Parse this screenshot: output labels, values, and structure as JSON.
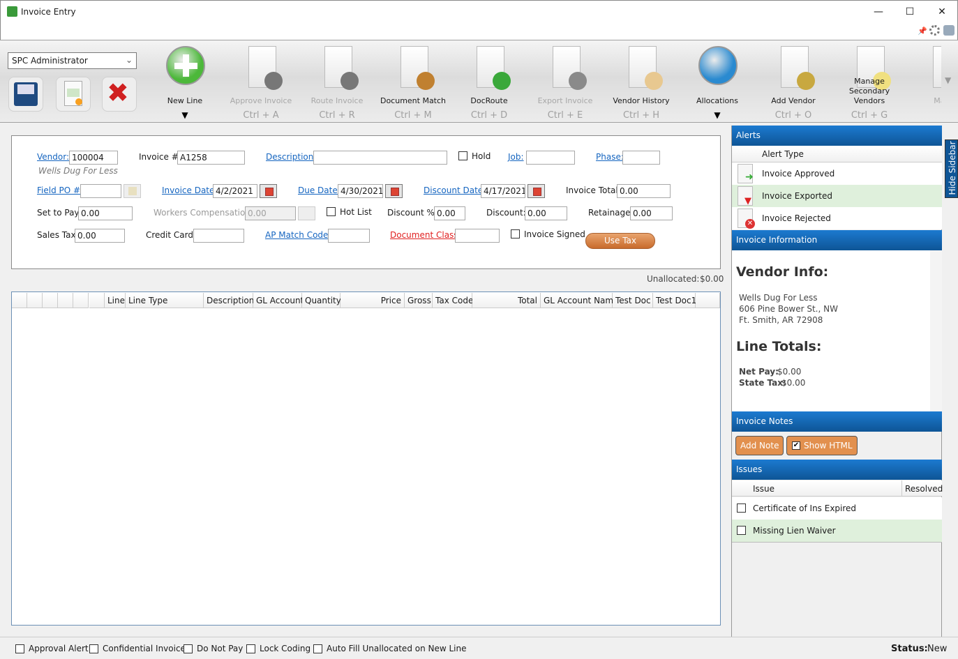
{
  "window": {
    "title": "Invoice Entry",
    "minimize": "—",
    "maximize": "☐",
    "close": "✕"
  },
  "toolbar": {
    "user": "SPC Administrator",
    "buttons": [
      {
        "label": "New Line",
        "shortcut": "▼",
        "enabled": true,
        "icon": "plus-circle-icon",
        "color": "#4cb83a"
      },
      {
        "label": "Approve Invoice",
        "shortcut": "Ctrl + A",
        "enabled": false,
        "icon": "approve-invoice-icon",
        "color": "#777777"
      },
      {
        "label": "Route Invoice",
        "shortcut": "Ctrl + R",
        "enabled": false,
        "icon": "route-invoice-icon",
        "color": "#777777"
      },
      {
        "label": "Document Match",
        "shortcut": "Ctrl + M",
        "enabled": true,
        "icon": "document-search-icon",
        "color": "#c08030"
      },
      {
        "label": "DocRoute",
        "shortcut": "Ctrl + D",
        "enabled": true,
        "icon": "doc-route-icon",
        "color": "#3aa83a"
      },
      {
        "label": "Export Invoice",
        "shortcut": "Ctrl + E",
        "enabled": false,
        "icon": "database-export-icon",
        "color": "#8a8a8a"
      },
      {
        "label": "Vendor History",
        "shortcut": "Ctrl + H",
        "enabled": true,
        "icon": "scroll-clock-icon",
        "color": "#e8c890"
      },
      {
        "label": "Allocations",
        "shortcut": "▼",
        "enabled": true,
        "icon": "pie-chart-icon",
        "color": "#2a8ad0"
      },
      {
        "label": "Add Vendor",
        "shortcut": "Ctrl + O",
        "enabled": true,
        "icon": "add-vendor-icon",
        "color": "#c8a840"
      },
      {
        "label": "Manage Secondary Vendors",
        "shortcut": "Ctrl + G",
        "enabled": true,
        "icon": "sales-quotation-icon",
        "color": "#f0e080"
      },
      {
        "label": "Match",
        "shortcut": "",
        "enabled": false,
        "icon": "match-icon",
        "color": "#aaaaaa"
      }
    ]
  },
  "form": {
    "vendor_label": "Vendor:",
    "vendor": "100004",
    "vendor_name": "Wells Dug For Less",
    "invoice_no_label": "Invoice #:",
    "invoice_no": "A1258",
    "description_label": "Description:",
    "description": "",
    "hold_label": "Hold",
    "job_label": "Job:",
    "job": "",
    "phase_label": "Phase:",
    "phase": "",
    "field_po_label": "Field PO #:",
    "field_po": "",
    "invoice_date_label": "Invoice Date:",
    "invoice_date": "4/2/2021",
    "due_date_label": "Due Date:",
    "due_date": "4/30/2021",
    "discount_date_label": "Discount Date:",
    "discount_date": "4/17/2021",
    "invoice_total_label": "Invoice Total:",
    "invoice_total": "0.00",
    "set_to_pay_label": "Set to Pay:",
    "set_to_pay": "0.00",
    "workers_comp_label": "Workers Compensation:",
    "workers_comp": "0.00",
    "hot_list_label": "Hot List",
    "discount_pct_label": "Discount %:",
    "discount_pct": "0.00",
    "discount_label": "Discount:",
    "discount": "0.00",
    "retainage_label": "Retainage:",
    "retainage": "0.00",
    "sales_tax_label": "Sales Tax:",
    "sales_tax": "0.00",
    "credit_card_label": "Credit Card:",
    "credit_card": "",
    "ap_match_label": "AP Match Code:",
    "ap_match": "",
    "doc_class_label": "Document Class:",
    "doc_class": "",
    "invoice_signed_label": "Invoice Signed",
    "use_tax": "Use Tax"
  },
  "unallocated": {
    "label": "Unallocated:",
    "value": "$0.00"
  },
  "grid": {
    "columns": [
      "Line",
      "Line Type",
      "Description",
      "GL Account",
      "Quantity",
      "Price",
      "Gross",
      "Tax Code",
      "Total",
      "GL Account Name",
      "Test Doc",
      "Test Doc1"
    ]
  },
  "sidebar": {
    "alerts_title": "Alerts",
    "alert_col": "Alert Type",
    "alerts": [
      "Invoice Approved",
      "Invoice Exported",
      "Invoice Rejected"
    ],
    "info_title": "Invoice Information",
    "vendor_info": "Vendor Info:",
    "address": [
      "Wells Dug For Less",
      "606 Pine Bower St., NW",
      "Ft. Smith, AR 72908"
    ],
    "line_totals": "Line Totals:",
    "net_pay_label": "Net Pay:",
    "net_pay": "$0.00",
    "state_tax_label": "State Tax:",
    "state_tax": "$0.00",
    "notes_title": "Invoice Notes",
    "add_note": "Add Note",
    "show_html": "Show HTML",
    "issues_title": "Issues",
    "issue_col": "Issue",
    "resolved_col": "Resolved",
    "issues": [
      "Certificate of Ins Expired",
      "Missing Lien Waiver"
    ],
    "hide": "Hide Sidebar"
  },
  "footer": {
    "checks": [
      "Approval Alert",
      "Confidential Invoice",
      "Do Not Pay",
      "Lock Coding",
      "Auto Fill Unallocated on New Line"
    ],
    "status_label": "Status:",
    "status": "New"
  }
}
